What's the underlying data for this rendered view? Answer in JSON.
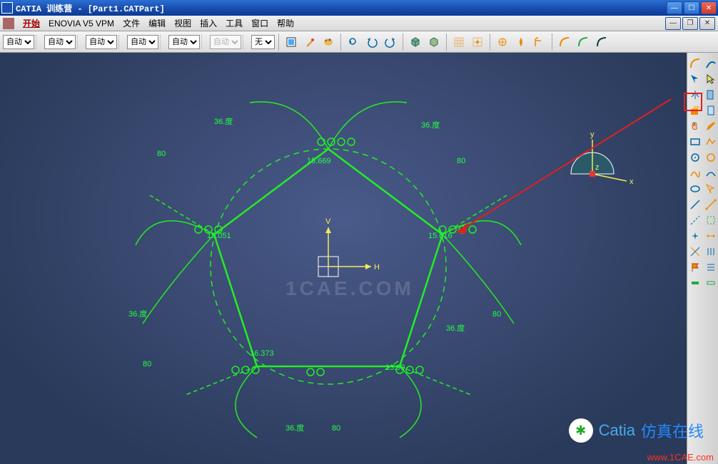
{
  "titlebar": {
    "title": "CATIA 训练营 - [Part1.CATPart]"
  },
  "menubar": {
    "start": "开始",
    "items": [
      "ENOVIA V5 VPM",
      "文件",
      "编辑",
      "视图",
      "插入",
      "工具",
      "窗口",
      "帮助"
    ]
  },
  "combos": {
    "c1": "自动",
    "c2": "自动",
    "c3": "自动",
    "c4": "自动",
    "c5": "自动",
    "c6": "自动",
    "c7": "无"
  },
  "axes": {
    "x": "x",
    "y": "y",
    "z": "z",
    "H": "H",
    "V": "V"
  },
  "dims": {
    "ang": "36.度",
    "len80": "80",
    "d_top": "15.669",
    "d_right": "15.616",
    "d_left": "15.051",
    "d_bl": "16.373",
    "d_br": "13.99",
    "d_bot": "36.度"
  },
  "watermark": {
    "url": "www.1CAE.com",
    "brand": "Catia",
    "tag": "仿真在线",
    "center": "1CAE.COM"
  },
  "icons": {
    "search": "search",
    "paint": "paint",
    "undo": "undo",
    "redo": "redo",
    "cube": "cube",
    "grid": "grid",
    "circle": "circle",
    "line": "line",
    "arc": "arc",
    "rect": "rect"
  }
}
